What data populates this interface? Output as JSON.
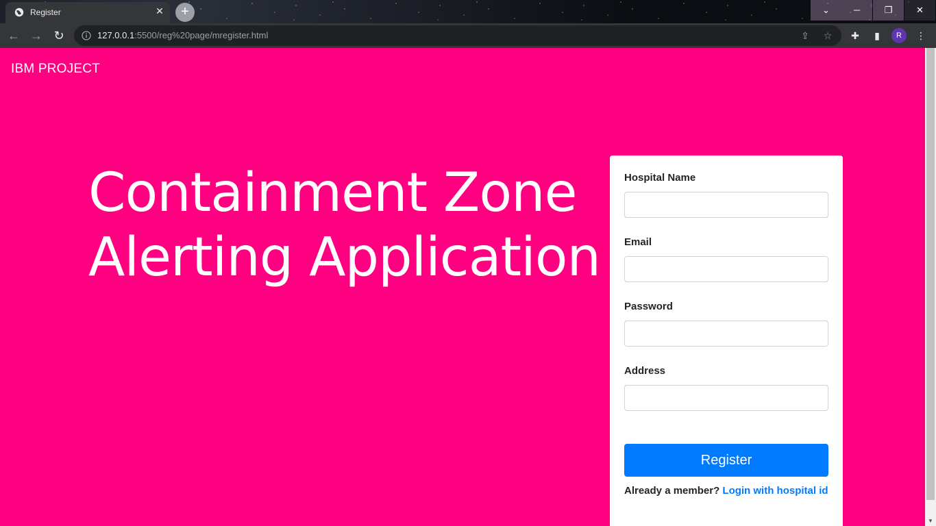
{
  "browser": {
    "tab_title": "Register",
    "tab_close": "✕",
    "new_tab": "+",
    "url_host": "127.0.0.1",
    "url_rest": ":5500/reg%20page/mregister.html",
    "profile_initial": "R"
  },
  "page": {
    "brand": "IBM PROJECT",
    "hero_line1": "Containment Zone",
    "hero_line2": "Alerting Application",
    "background_color": "#ff0080"
  },
  "form": {
    "hospital_name_label": "Hospital Name",
    "hospital_name_value": "",
    "email_label": "Email",
    "email_value": "",
    "password_label": "Password",
    "password_value": "",
    "address_label": "Address",
    "address_value": "",
    "register_label": "Register",
    "member_text": "Already a member?",
    "login_link": "Login with hospital id",
    "button_color": "#007bff"
  }
}
